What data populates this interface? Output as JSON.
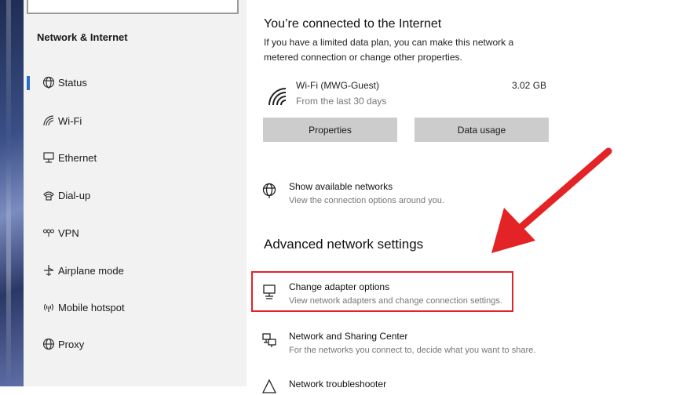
{
  "sidebar": {
    "title": "Network & Internet",
    "items": [
      {
        "label": "Status",
        "icon": "globe-icon",
        "selected": true
      },
      {
        "label": "Wi-Fi",
        "icon": "wifi-icon"
      },
      {
        "label": "Ethernet",
        "icon": "ethernet-icon"
      },
      {
        "label": "Dial-up",
        "icon": "phone-icon"
      },
      {
        "label": "VPN",
        "icon": "vpn-icon"
      },
      {
        "label": "Airplane mode",
        "icon": "airplane-icon"
      },
      {
        "label": "Mobile hotspot",
        "icon": "hotspot-icon"
      },
      {
        "label": "Proxy",
        "icon": "globe-icon"
      }
    ]
  },
  "status": {
    "heading": "You’re connected to the Internet",
    "desc_line1": "If you have a limited data plan, you can make this network a",
    "desc_line2": "metered connection or change other properties.",
    "network_name": "Wi-Fi (MWG-Guest)",
    "network_sub": "From the last 30 days",
    "data_used": "3.02 GB",
    "properties_label": "Properties",
    "data_usage_label": "Data usage"
  },
  "show_networks": {
    "title": "Show available networks",
    "sub": "View the connection options around you."
  },
  "advanced": {
    "heading": "Advanced network settings",
    "change_adapter_title": "Change adapter options",
    "change_adapter_sub": "View network adapters and change connection settings.",
    "sharing_title": "Network and Sharing Center",
    "sharing_sub": "For the networks you connect to, decide what you want to share.",
    "troubleshooter_title": "Network troubleshooter"
  },
  "colors": {
    "accent": "#2b6cc4",
    "annotation_red": "#e32326",
    "sidebar_bg": "#f2f2f2",
    "button_bg": "#cccccc"
  }
}
